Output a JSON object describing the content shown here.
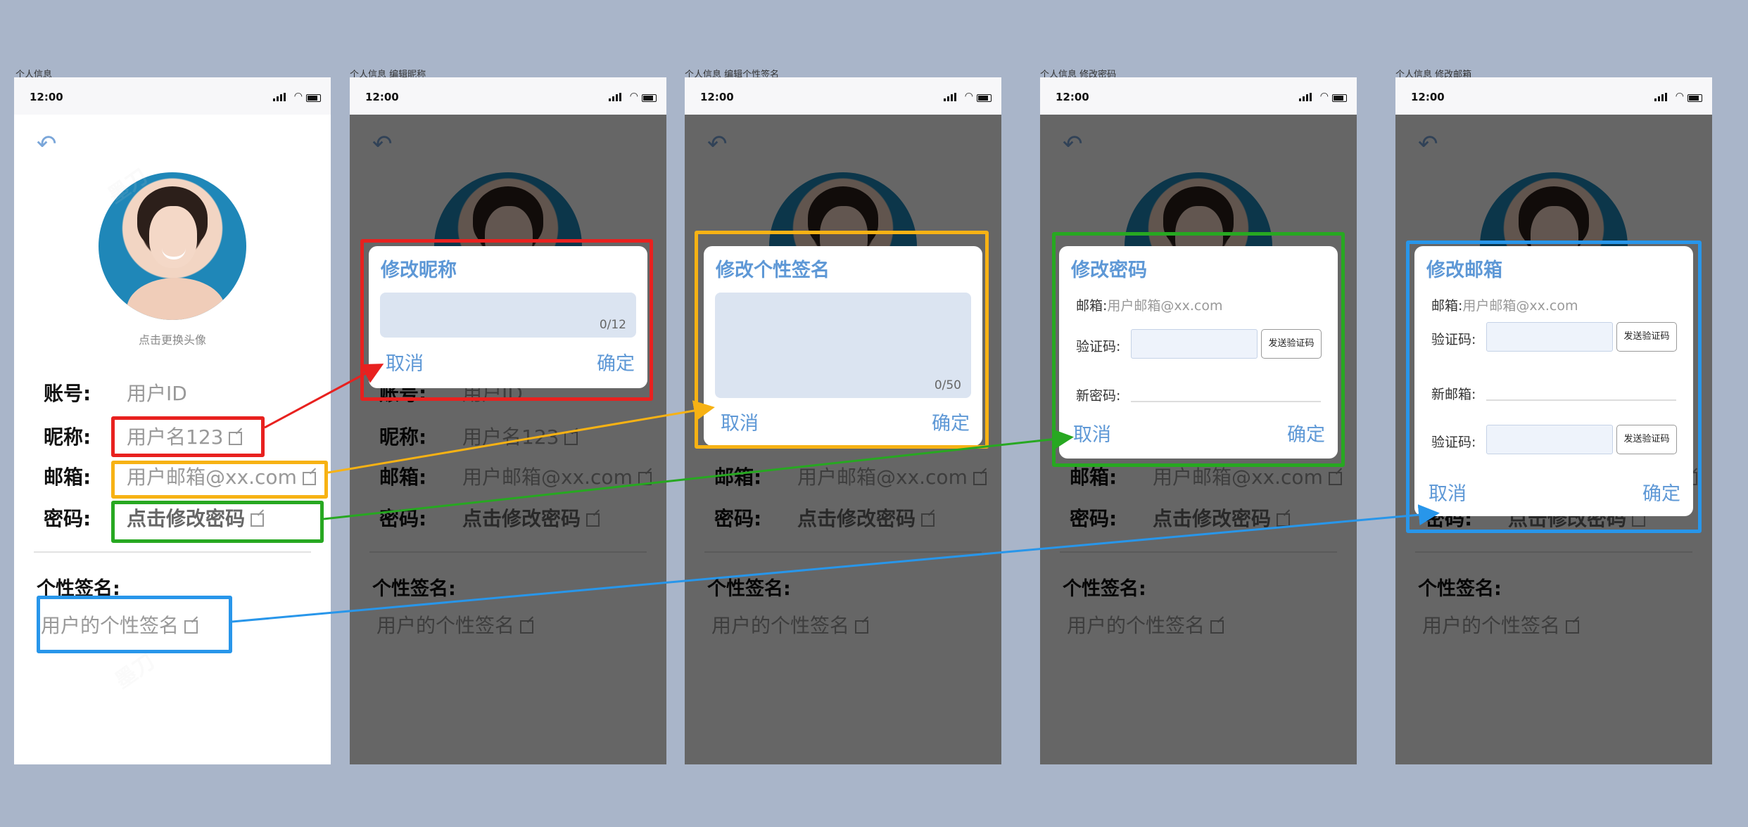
{
  "screens": [
    {
      "title": "个人信息",
      "time": "12:00"
    },
    {
      "title": "个人信息 编辑昵称",
      "time": "12:00"
    },
    {
      "title": "个人信息 编辑个性签名",
      "time": "12:00"
    },
    {
      "title": "个人信息 修改密码",
      "time": "12:00"
    },
    {
      "title": "个人信息 修改邮箱",
      "time": "12:00"
    }
  ],
  "profile": {
    "avatar_hint": "点击更换头像",
    "account_label": "账号:",
    "account_value": "用户ID",
    "nickname_label": "昵称:",
    "nickname_value": "用户名123",
    "email_label": "邮箱:",
    "email_value": "用户邮箱@xx.com",
    "password_label": "密码:",
    "password_value": "点击修改密码",
    "signature_label": "个性签名:",
    "signature_value": "用户的个性签名"
  },
  "dialogs": {
    "nickname": {
      "title": "修改昵称",
      "counter": "0/12",
      "cancel": "取消",
      "confirm": "确定"
    },
    "signature": {
      "title": "修改个性签名",
      "counter": "0/50",
      "cancel": "取消",
      "confirm": "确定"
    },
    "password": {
      "title": "修改密码",
      "email_label": "邮箱:",
      "email_value": "用户邮箱@xx.com",
      "code_label": "验证码:",
      "send_code": "发送验证码",
      "new_password_label": "新密码:",
      "cancel": "取消",
      "confirm": "确定"
    },
    "email": {
      "title": "修改邮箱",
      "email_label": "邮箱:",
      "email_value": "用户邮箱@xx.com",
      "code_label": "验证码:",
      "send_code": "发送验证码",
      "new_email_label": "新邮箱:",
      "code_label_2": "验证码:",
      "cancel": "取消",
      "confirm": "确定"
    }
  },
  "watermark": "墨刀",
  "colors": {
    "background": "#a9b5c9",
    "accent": "#5e98d6",
    "red": "#e8211f",
    "yellow": "#f7b214",
    "green": "#27a821",
    "blue": "#2896ea"
  }
}
